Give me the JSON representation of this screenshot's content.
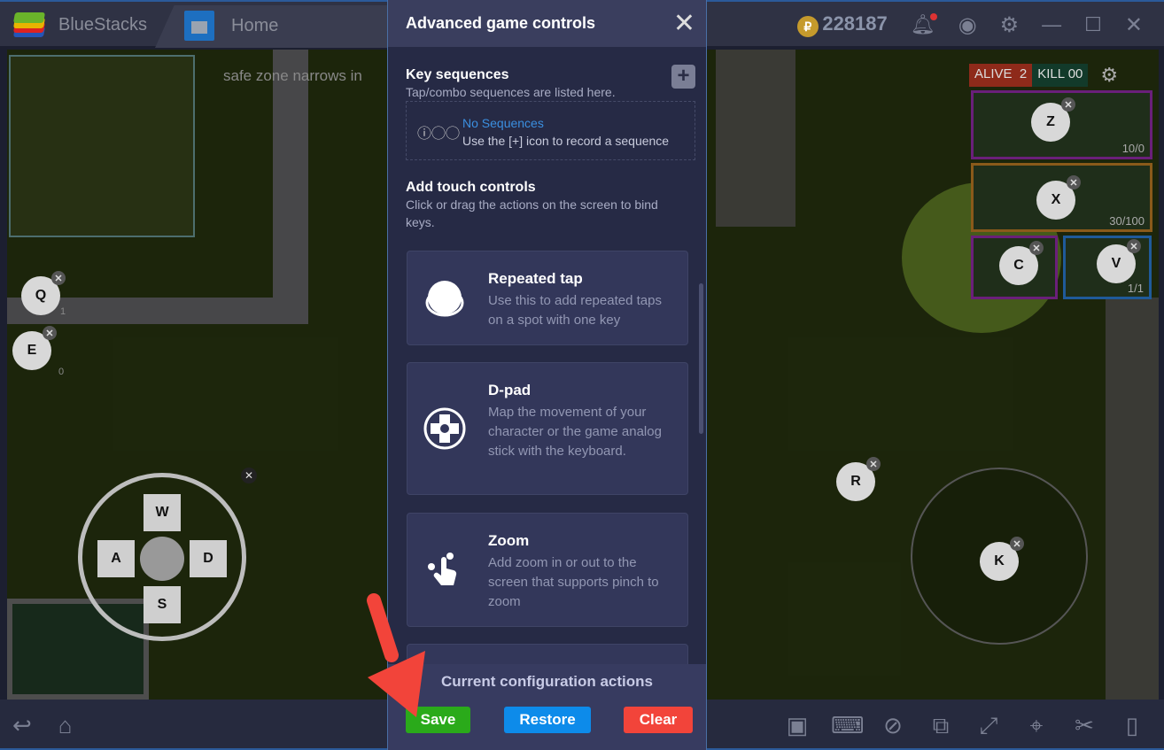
{
  "window": {
    "app_name": "BlueStacks",
    "tab": "Home",
    "coins": "228187"
  },
  "game": {
    "notice": "safe zone narrows in",
    "hud": {
      "alive_label": "ALIVE",
      "alive": "2",
      "kill_label": "KILL",
      "kill": "00"
    },
    "weapons": [
      {
        "key": "Z",
        "ammo": "10/0"
      },
      {
        "key": "X",
        "ammo": "30/100"
      },
      {
        "key": "C",
        "ammo": ""
      },
      {
        "key": "V",
        "ammo": "1/1"
      }
    ],
    "side_keys": [
      {
        "key": "Q",
        "count": "1"
      },
      {
        "key": "E",
        "count": "0"
      }
    ],
    "dpad": {
      "up": "W",
      "left": "A",
      "right": "D",
      "down": "S"
    },
    "reload_key": "R",
    "aim_key": "K"
  },
  "panel": {
    "title": "Advanced game controls",
    "key_sequences": {
      "title": "Key sequences",
      "subtitle": "Tap/combo sequences are listed here.",
      "empty_title": "No Sequences",
      "empty_hint": "Use the [+] icon to record a sequence"
    },
    "touch": {
      "title": "Add touch controls",
      "subtitle": "Click or drag the actions on the screen to bind keys."
    },
    "cards": [
      {
        "title": "Repeated tap",
        "desc": "Use this to add repeated taps on a spot with one key",
        "icon": "repeated-tap-icon"
      },
      {
        "title": "D-pad",
        "desc": "Map the movement of your character or the game analog stick with the keyboard.",
        "icon": "dpad-icon"
      },
      {
        "title": "Zoom",
        "desc": "Add zoom in or out to the screen that supports pinch to zoom",
        "icon": "pinch-zoom-icon"
      }
    ],
    "footer": {
      "title": "Current configuration actions",
      "save": "Save",
      "restore": "Restore",
      "clear": "Clear"
    }
  },
  "colors": {
    "save": "#2aaa1a",
    "restore": "#0d8bea",
    "clear": "#f2443a",
    "link": "#3b8fe0",
    "annotation_arrow": "#f2443a"
  }
}
